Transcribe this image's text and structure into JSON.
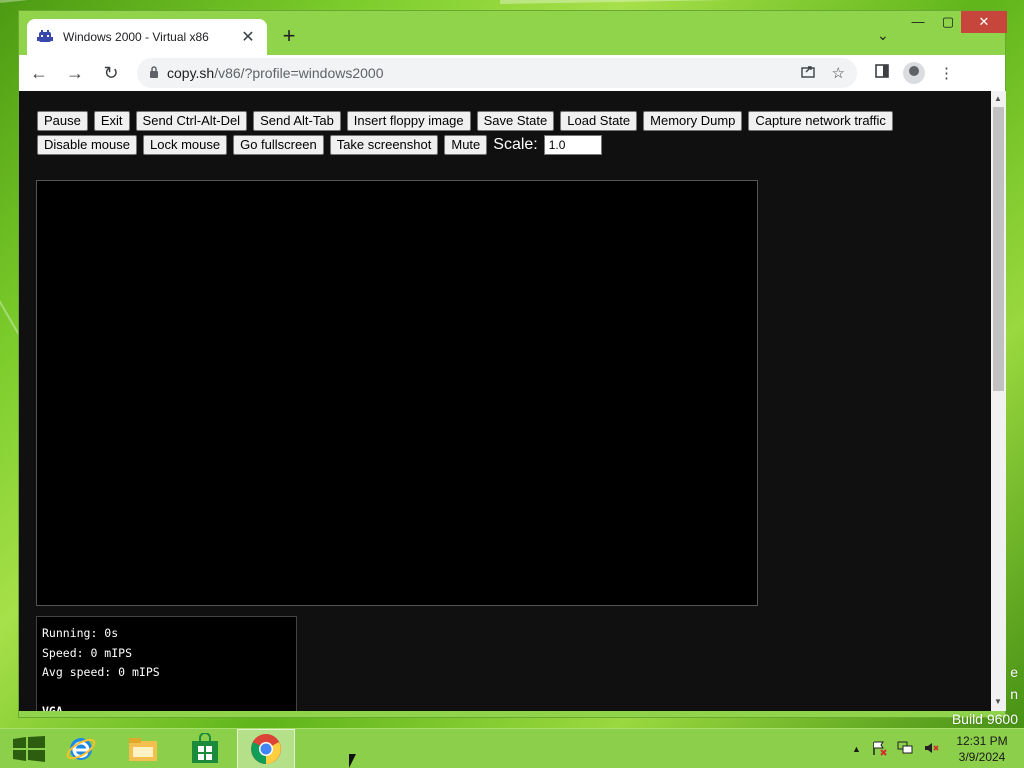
{
  "browser": {
    "tab_title": "Windows 2000 - Virtual x86",
    "tab_close": "✕",
    "new_tab": "+",
    "url_host": "copy.sh",
    "url_path": "/v86/?profile=windows2000"
  },
  "window_controls": {
    "minimize": "—",
    "maximize": "▢",
    "close": "✕"
  },
  "emulator": {
    "buttons_row1": [
      "Pause",
      "Exit",
      "Send Ctrl-Alt-Del",
      "Send Alt-Tab",
      "Insert floppy image",
      "Save State",
      "Load State",
      "Memory Dump",
      "Capture network traffic"
    ],
    "buttons_row2": [
      "Disable mouse",
      "Lock mouse",
      "Go fullscreen",
      "Take screenshot",
      "Mute"
    ],
    "scale_label": "Scale:",
    "scale_value": "1.0",
    "stats": {
      "running": "Running: 0s",
      "speed": "Speed: 0 mIPS",
      "avg_speed": "Avg speed: 0 mIPS",
      "vga": "VGA"
    }
  },
  "desktop": {
    "watermark_line1": "e",
    "watermark_line2": "n",
    "watermark_build": "Build 9600"
  },
  "taskbar": {
    "clock_time": "12:31 PM",
    "clock_date": "3/9/2024",
    "tray_expand": "▲"
  },
  "colors": {
    "desktop_green": "#7ccd2c",
    "chrome_frame": "#8fd44a",
    "page_background": "#101010",
    "close_red": "#c7463b"
  },
  "icons": [
    "start-windows-icon",
    "internet-explorer-icon",
    "file-explorer-icon",
    "store-icon",
    "chrome-icon",
    "flag-icon",
    "network-icon",
    "speaker-muted-icon",
    "lock-icon",
    "share-icon",
    "star-icon",
    "side-panel-icon",
    "kebab-menu-icon"
  ]
}
